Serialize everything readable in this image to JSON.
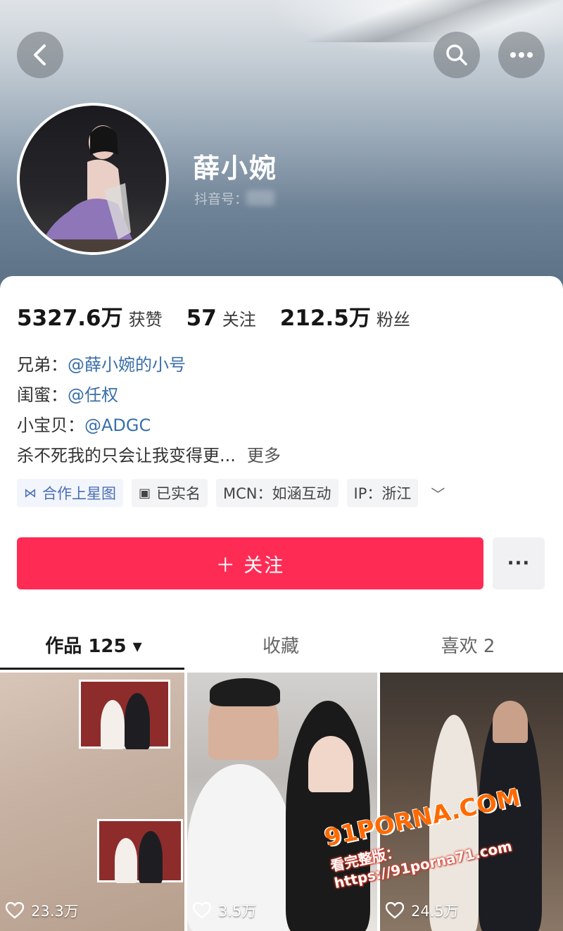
{
  "profile": {
    "name": "薛小婉",
    "douyin_id_label": "抖音号："
  },
  "stats": [
    {
      "value": "5327.6万",
      "label": "获赞"
    },
    {
      "value": "57",
      "label": "关注"
    },
    {
      "value": "212.5万",
      "label": "粉丝"
    }
  ],
  "bio": {
    "line1_prefix": "兄弟：",
    "line1_link": "@薛小婉的小号",
    "line2_prefix": "闺蜜：",
    "line2_link": "@任权",
    "line3_prefix": "小宝贝：",
    "line3_link": "@ADGC",
    "line4_text": "杀不死我的只会让我变得更...",
    "more_label": "更多"
  },
  "tags": {
    "starmap": "合作上星图",
    "verified": "已实名",
    "mcn": "MCN：如涵互动",
    "ip": "IP：浙江"
  },
  "actions": {
    "follow_label": "＋ 关注",
    "more_label": "···"
  },
  "tabs": {
    "works": "作品 125 ▾",
    "favorites": "收藏",
    "likes": "喜欢 2"
  },
  "videos": [
    {
      "likes": "23.3万"
    },
    {
      "likes": "3.5万"
    },
    {
      "likes": "24.5万"
    }
  ],
  "watermark": {
    "site": "91PORNA.COM",
    "url": "看完整版：https://91porna71.com"
  },
  "colors": {
    "follow": "#fe2c55",
    "link": "#3a6fa8"
  }
}
